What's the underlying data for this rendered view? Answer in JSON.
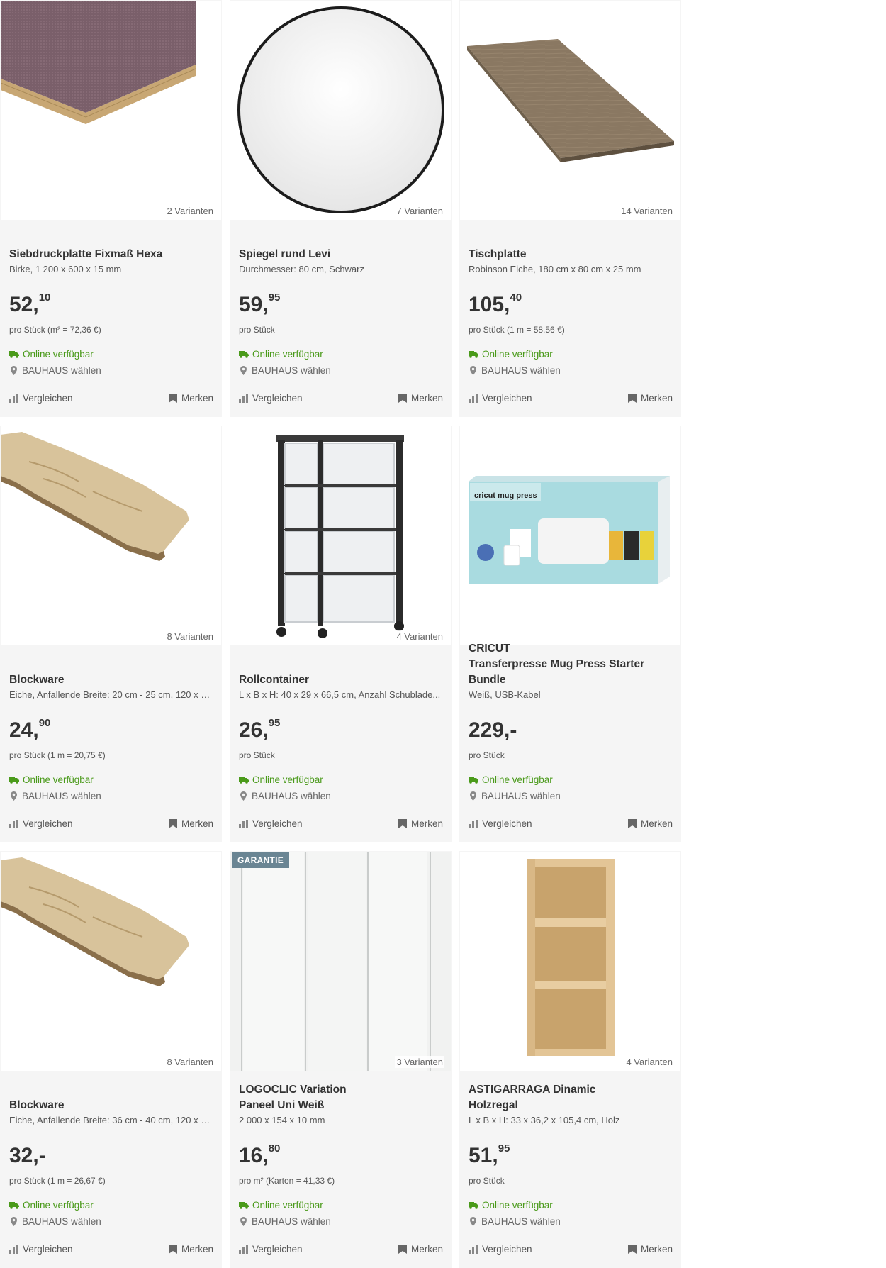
{
  "labels": {
    "availability": "Online verfügbar",
    "store": "BAUHAUS wählen",
    "compare": "Vergleichen",
    "bookmark": "Merken"
  },
  "colors": {
    "availability_green": "#4a9a1a",
    "badge_blue": "#6a8593",
    "card_bg": "#f5f5f5"
  },
  "products": [
    {
      "brand": "",
      "title": "Siebdruckplatte Fixmaß Hexa",
      "subtitle": "Birke, 1 200 x 600 x 15 mm",
      "price_main": "52,",
      "price_cents": "10",
      "unit": "pro Stück (m² = 72,36 €)",
      "variants": "2 Varianten",
      "badge": "",
      "image": "plywood-board"
    },
    {
      "brand": "",
      "title": "Spiegel rund Levi",
      "subtitle": "Durchmesser: 80 cm, Schwarz",
      "price_main": "59,",
      "price_cents": "95",
      "unit": "pro Stück",
      "variants": "7 Varianten",
      "badge": "",
      "image": "round-mirror"
    },
    {
      "brand": "",
      "title": "Tischplatte",
      "subtitle": "Robinson Eiche, 180 cm x 80 cm x 25 mm",
      "price_main": "105,",
      "price_cents": "40",
      "unit": "pro Stück (1 m = 58,56 €)",
      "variants": "14 Varianten",
      "badge": "",
      "image": "table-top"
    },
    {
      "brand": "",
      "title": "Blockware",
      "subtitle": "Eiche, Anfallende Breite: 20 cm - 25 cm, 120 x 2,...",
      "price_main": "24,",
      "price_cents": "90",
      "unit": "pro Stück (1 m = 20,75 €)",
      "variants": "8 Varianten",
      "badge": "",
      "image": "live-edge-board"
    },
    {
      "brand": "",
      "title": "Rollcontainer",
      "subtitle": "L x B x H: 40 x 29 x 66,5 cm, Anzahl Schublade...",
      "price_main": "26,",
      "price_cents": "95",
      "unit": "pro Stück",
      "variants": "4 Varianten",
      "badge": "",
      "image": "drawer-cart"
    },
    {
      "brand": "CRICUT",
      "title": "Transferpresse Mug Press Starter Bundle",
      "subtitle": "Weiß, USB-Kabel",
      "price_main": "229,-",
      "price_cents": "",
      "unit": "pro Stück",
      "variants": "",
      "badge": "",
      "image": "cricut-box"
    },
    {
      "brand": "",
      "title": "Blockware",
      "subtitle": "Eiche, Anfallende Breite: 36 cm - 40 cm, 120 x 2,...",
      "price_main": "32,-",
      "price_cents": "",
      "unit": "pro Stück (1 m = 26,67 €)",
      "variants": "8 Varianten",
      "badge": "",
      "image": "live-edge-board"
    },
    {
      "brand": "LOGOCLIC Variation",
      "title": "Paneel Uni Weiß",
      "subtitle": "2 000 x 154 x 10 mm",
      "price_main": "16,",
      "price_cents": "80",
      "unit": "pro m² (Karton = 41,33 €)",
      "variants": "3 Varianten",
      "badge": "GARANTIE",
      "image": "white-panel"
    },
    {
      "brand": "ASTIGARRAGA Dinamic",
      "title": "Holzregal",
      "subtitle": "L x B x H: 33 x 36,2 x 105,4 cm, Holz",
      "price_main": "51,",
      "price_cents": "95",
      "unit": "pro Stück",
      "variants": "4 Varianten",
      "badge": "",
      "image": "wood-shelf"
    }
  ]
}
